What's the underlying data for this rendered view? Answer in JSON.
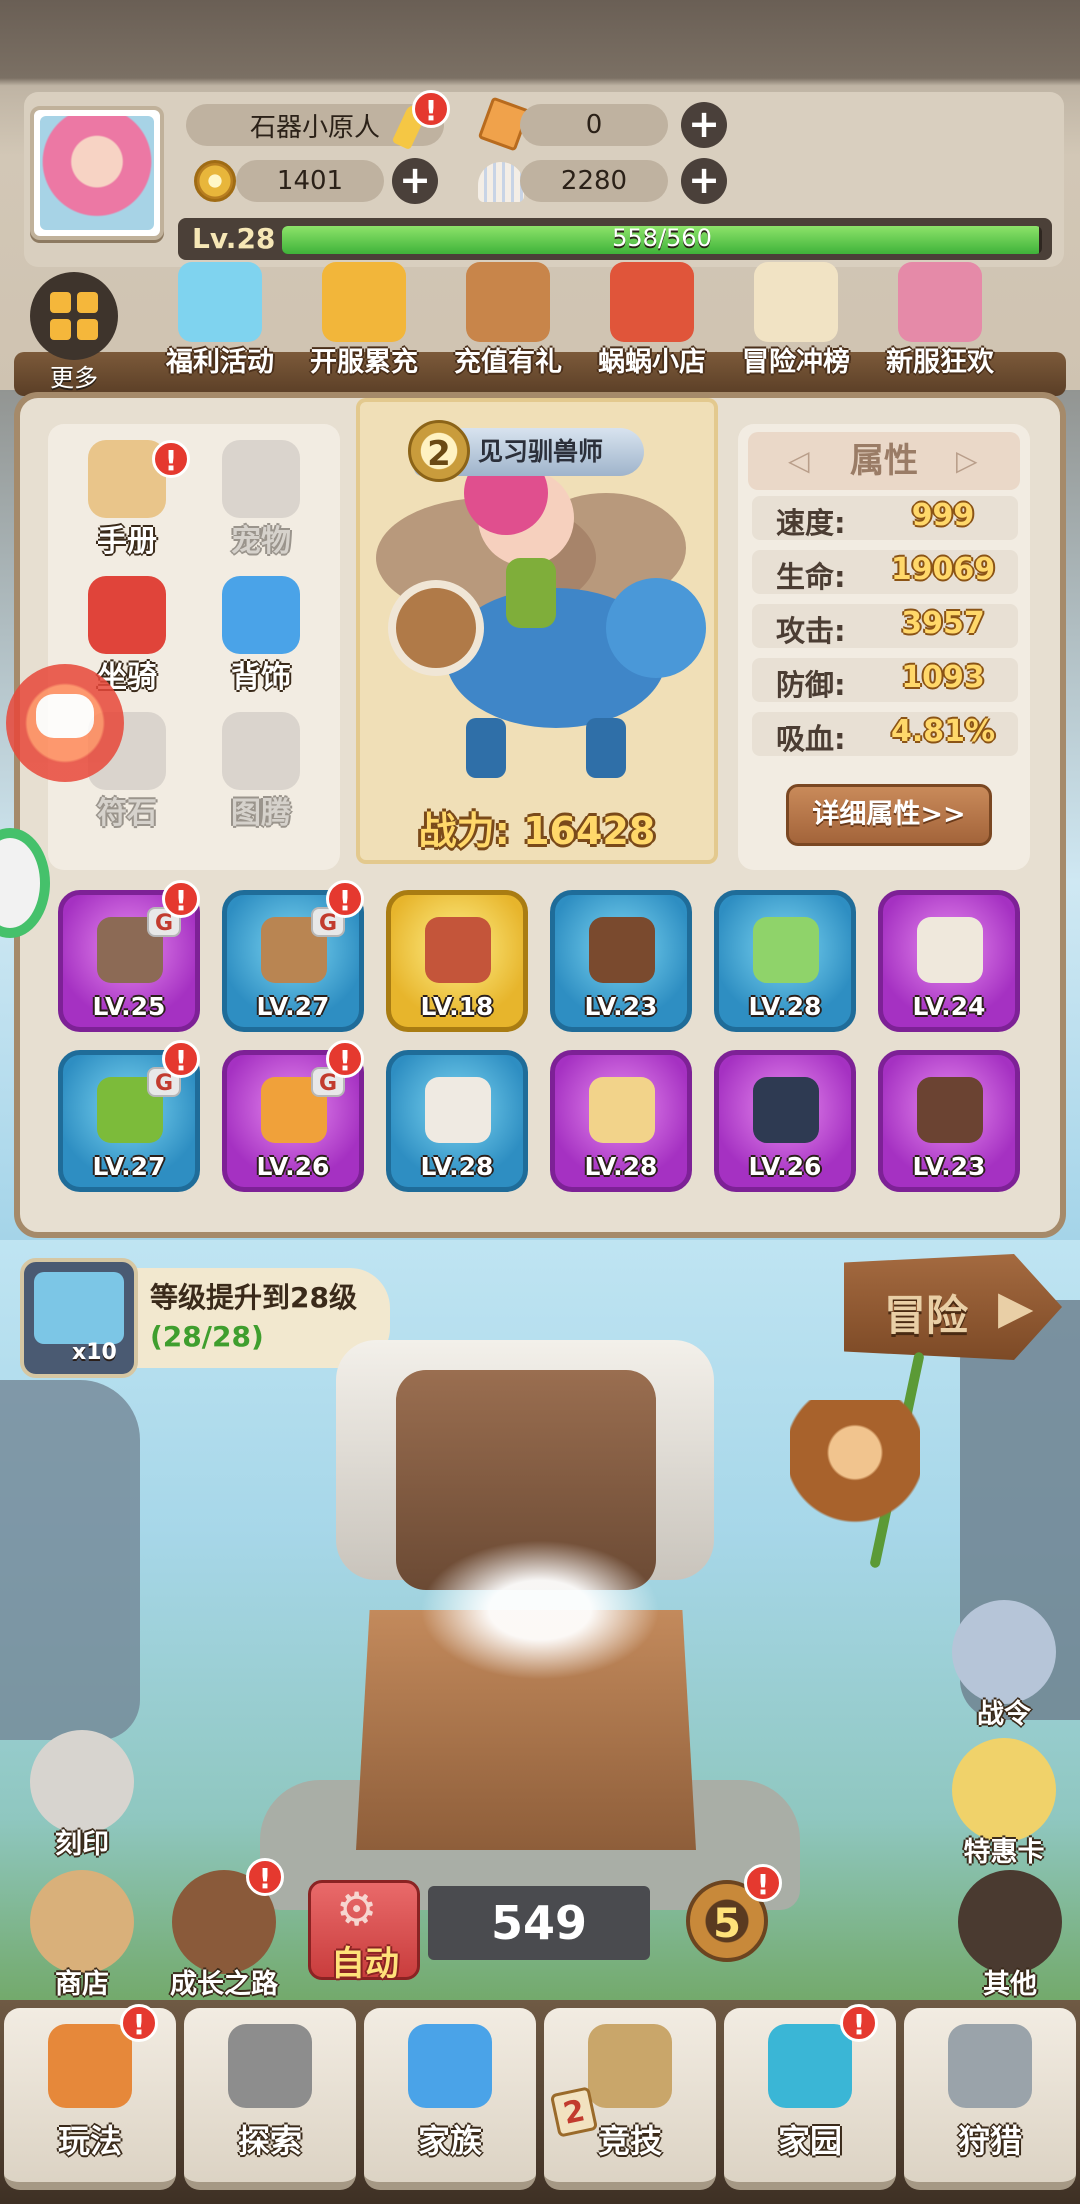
{
  "player": {
    "name": "石器小原人",
    "level_label": "Lv.28",
    "xp_text": "558/560",
    "xp_fraction": 0.996,
    "tickets": "0",
    "coins": "1401",
    "shells": "2280"
  },
  "more_label": "更多",
  "events": [
    {
      "label": "福利活动",
      "color": "#7fd3ef"
    },
    {
      "label": "开服累充",
      "color": "#f2b63a"
    },
    {
      "label": "充值有礼",
      "color": "#c8854a"
    },
    {
      "label": "蜗蜗小店",
      "color": "#e0553a"
    },
    {
      "label": "冒险冲榜",
      "color": "#f1e3c4"
    },
    {
      "label": "新服狂欢",
      "color": "#e58aa8"
    }
  ],
  "menu": [
    {
      "label": "手册",
      "active": true,
      "color": "#e9c58a"
    },
    {
      "label": "宠物",
      "active": false,
      "color": "#c9c5bf"
    },
    {
      "label": "坐骑",
      "active": true,
      "color": "#e0443a"
    },
    {
      "label": "背饰",
      "active": true,
      "color": "#4aa3e8"
    },
    {
      "label": "符石",
      "active": false,
      "color": "#c9c5bf"
    },
    {
      "label": "图腾",
      "active": false,
      "color": "#c9c5bf"
    }
  ],
  "hero": {
    "rank_number": "2",
    "rank_title": "见习驯兽师",
    "power": "战力: 16428"
  },
  "attributes": {
    "title": "属性",
    "rows": [
      {
        "name": "速度:",
        "value": "999"
      },
      {
        "name": "生命:",
        "value": "19069"
      },
      {
        "name": "攻击:",
        "value": "3957"
      },
      {
        "name": "防御:",
        "value": "1093"
      },
      {
        "name": "吸血:",
        "value": "4.81%"
      }
    ],
    "detail_button": "详细属性>>"
  },
  "equipment": [
    {
      "level": "LV.25",
      "rarity": "purple",
      "tag": "G",
      "alert": "!",
      "color": "#8c6a55"
    },
    {
      "level": "LV.27",
      "rarity": "blue",
      "tag": "G",
      "alert": "!",
      "color": "#b98552"
    },
    {
      "level": "LV.18",
      "rarity": "gold",
      "tag": "",
      "alert": "",
      "color": "#c4553a"
    },
    {
      "level": "LV.23",
      "rarity": "blue",
      "tag": "",
      "alert": "",
      "color": "#7a4a2e"
    },
    {
      "level": "LV.28",
      "rarity": "blue",
      "tag": "",
      "alert": "",
      "color": "#8fd36a"
    },
    {
      "level": "LV.24",
      "rarity": "purple",
      "tag": "",
      "alert": "",
      "color": "#efe8dc"
    },
    {
      "level": "LV.27",
      "rarity": "blue",
      "tag": "G",
      "alert": "!",
      "color": "#7cbb3a"
    },
    {
      "level": "LV.26",
      "rarity": "purple",
      "tag": "G",
      "alert": "!",
      "color": "#f0a13a"
    },
    {
      "level": "LV.28",
      "rarity": "blue",
      "tag": "",
      "alert": "",
      "color": "#efeae2"
    },
    {
      "level": "LV.28",
      "rarity": "purple",
      "tag": "",
      "alert": "",
      "color": "#f2d38a"
    },
    {
      "level": "LV.26",
      "rarity": "purple",
      "tag": "",
      "alert": "",
      "color": "#2e3a52"
    },
    {
      "level": "LV.23",
      "rarity": "purple",
      "tag": "",
      "alert": "",
      "color": "#6b4332"
    }
  ],
  "quest": {
    "title": "等级提升到28级",
    "progress": "(28/28)",
    "reward_count": "x10"
  },
  "adventure_label": "冒险",
  "right_buttons": [
    {
      "label": "战令",
      "color": "#b6c5d8"
    },
    {
      "label": "特惠卡",
      "color": "#f0d26a"
    },
    {
      "label": "其他",
      "color": "#4a3a30"
    }
  ],
  "left_buttons": [
    {
      "label": "刻印",
      "color": "#d7d4cf"
    },
    {
      "label": "商店",
      "color": "#d9b07a"
    },
    {
      "label": "成长之路",
      "color": "#8a5a3a"
    }
  ],
  "auto_label": "自动",
  "chest_count": "549",
  "stage_badge": "5",
  "nav": [
    {
      "label": "玩法",
      "alert": "!",
      "color": "#e6883a"
    },
    {
      "label": "探索",
      "alert": "",
      "color": "#8d8d8d"
    },
    {
      "label": "家族",
      "alert": "",
      "color": "#4aa3e8"
    },
    {
      "label": "竞技",
      "alert": "",
      "color": "#c9a66a",
      "badge": "2"
    },
    {
      "label": "家园",
      "alert": "!",
      "color": "#3ab6d6"
    },
    {
      "label": "狩猎",
      "alert": "",
      "color": "#9aa3aa"
    }
  ],
  "alert_symbol": "!"
}
